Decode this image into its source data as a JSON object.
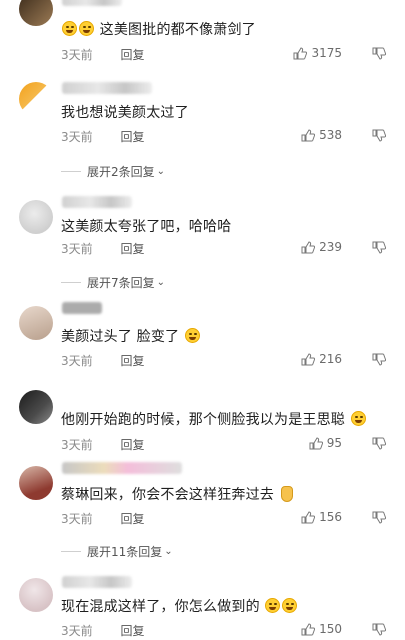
{
  "comments": [
    {
      "text": "这美图批的都不像萧剑了",
      "time": "3天前",
      "reply": "回复",
      "likes": "3175",
      "emoji_prefix": 2
    },
    {
      "text": "我也想说美颜太过了",
      "time": "3天前",
      "reply": "回复",
      "likes": "538",
      "expand": "展开2条回复"
    },
    {
      "text": "这美颜太夸张了吧，哈哈哈",
      "time": "3天前",
      "reply": "回复",
      "likes": "239",
      "expand": "展开7条回复"
    },
    {
      "text": "美颜过头了  脸变了",
      "time": "3天前",
      "reply": "回复",
      "likes": "216"
    },
    {
      "text": "他刚开始跑的时候，那个侧脸我以为是王思聪",
      "time": "3天前",
      "reply": "回复",
      "likes": "95"
    },
    {
      "text": "蔡琳回来，你会不会这样狂奔过去",
      "time": "3天前",
      "reply": "回复",
      "likes": "156",
      "expand": "展开11条回复"
    },
    {
      "text": "现在混成这样了，你怎么做到的",
      "time": "3天前",
      "reply": "回复",
      "likes": "150"
    }
  ]
}
